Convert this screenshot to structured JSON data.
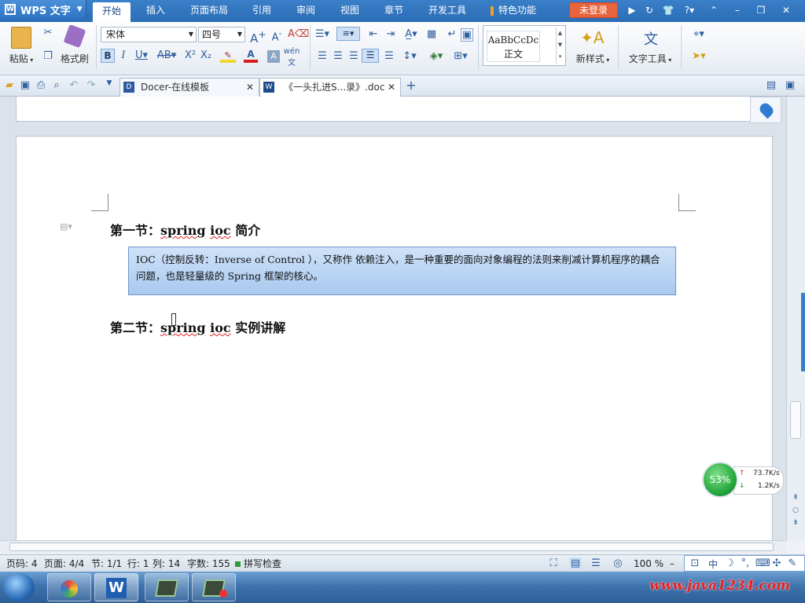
{
  "app": {
    "name": "WPS 文字",
    "icon": "wps-writer-icon"
  },
  "menu": {
    "items": [
      "开始",
      "插入",
      "页面布局",
      "引用",
      "审阅",
      "视图",
      "章节",
      "开发工具",
      "特色功能"
    ],
    "active": "开始",
    "login_label": "未登录"
  },
  "ribbon": {
    "paste_label": "粘贴",
    "format_painter_label": "格式刷",
    "font_name": "宋体",
    "font_size": "四号",
    "style_preview": "AaBbCcDc",
    "style_name": "正文",
    "new_style_label": "新样式",
    "text_tools_label": "文字工具"
  },
  "tabs": [
    {
      "label": "Docer-在线模板",
      "active": false
    },
    {
      "label": "《一头扎进S...录》.doc",
      "active": true
    }
  ],
  "document": {
    "heading1_prefix": "第一节：",
    "heading1_word1": "spring",
    "heading1_word2": "ioc",
    "heading1_suffix": " 简介",
    "ioc_text": "IOC（控制反转：Inverse of Control ），又称作 依赖注入，是一种重要的面向对象编程的法则来削减计算机程序的耦合问题，也是轻量级的 Spring 框架的核心。",
    "heading2_prefix": "第二节：",
    "heading2_word1": "spring",
    "heading2_word2": "ioc",
    "heading2_suffix": " 实例讲解"
  },
  "status": {
    "page_code": "页码: 4",
    "pages": "页面: 4/4",
    "section": "节: 1/1",
    "row": "行: 1",
    "col": "列: 14",
    "word_count": "字数: 155",
    "spell_check": "拼写检查",
    "zoom": "100 %"
  },
  "net_widget": {
    "percent": "53%",
    "upload": "73.7K/s",
    "download": "1.2K/s"
  },
  "watermark": "www.java1234.com",
  "colors": {
    "menubar": "#2b6db5",
    "accent": "#1f4e8c",
    "login": "#e8643c",
    "iocbox": "#a9c9ef"
  }
}
